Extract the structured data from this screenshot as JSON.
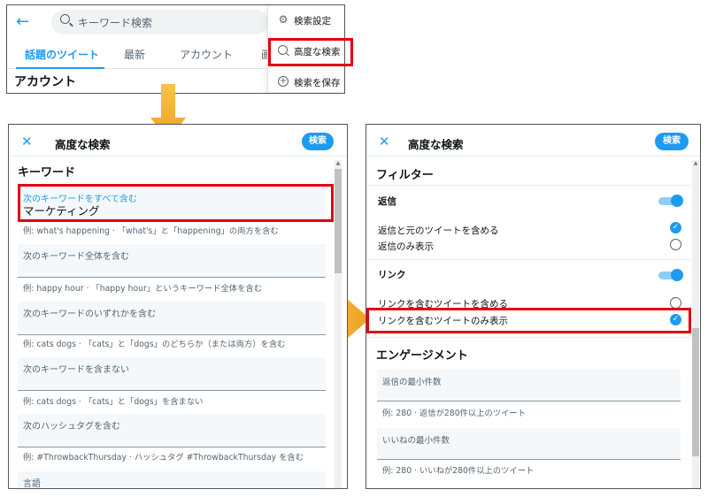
{
  "top": {
    "back_icon": "←",
    "search_placeholder": "キーワード検索",
    "tabs": [
      "話題のツイート",
      "最新",
      "アカウント",
      "画"
    ],
    "section_title": "アカウント",
    "menu": [
      {
        "icon": "gear-icon",
        "label": "検索設定"
      },
      {
        "icon": "search-icon",
        "label": "高度な検索"
      },
      {
        "icon": "plus-circle-icon",
        "label": "検索を保存"
      }
    ]
  },
  "left": {
    "close": "✕",
    "title": "高度な検索",
    "search_button": "検索",
    "section": "キーワード",
    "fields": [
      {
        "label": "次のキーワードをすべて含む",
        "value": "マーケティング",
        "hint": "例: what's happening · 「what's」と「happening」の両方を含む"
      },
      {
        "label": "次のキーワード全体を含む",
        "value": "",
        "hint": "例: happy hour · 「happy hour」というキーワード全体を含む"
      },
      {
        "label": "次のキーワードのいずれかを含む",
        "value": "",
        "hint": "例: cats dogs · 「cats」と「dogs」のどちらか（または両方）を含む"
      },
      {
        "label": "次のキーワードを含まない",
        "value": "",
        "hint": "例: cats dogs · 「cats」と「dogs」を含まない"
      },
      {
        "label": "次のハッシュタグを含む",
        "value": "",
        "hint": "例: #ThrowbackThursday · ハッシュタグ #ThrowbackThursday を含む"
      }
    ],
    "language_label": "言語"
  },
  "right": {
    "close": "✕",
    "title": "高度な検索",
    "search_button": "検索",
    "filters_title": "フィルター",
    "replies_label": "返信",
    "replies_include": "返信と元のツイートを含める",
    "replies_only": "返信のみ表示",
    "links_label": "リンク",
    "links_include": "リンクを含むツイートを含める",
    "links_only": "リンクを含むツイートのみ表示",
    "engagement_title": "エンゲージメント",
    "min_replies_label": "返信の最小件数",
    "min_replies_hint": "例: 280 · 返信が280件以上のツイート",
    "min_likes_label": "いいねの最小件数",
    "min_likes_hint": "例: 280 · いいねが280件以上のツイート",
    "check": "✓"
  },
  "colors": {
    "accent": "#1d9bf0",
    "highlight": "#e3000f",
    "arrow": "#f5b82e"
  }
}
